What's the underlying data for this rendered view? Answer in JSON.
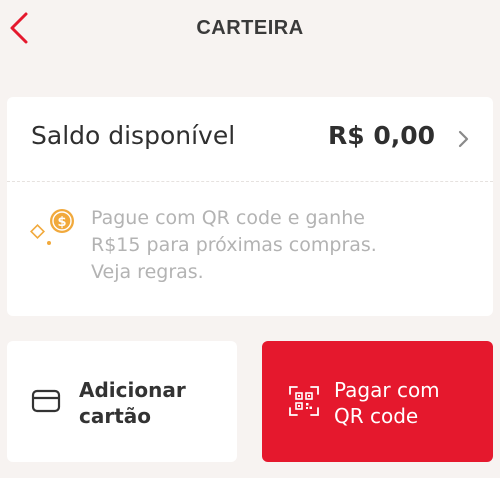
{
  "colors": {
    "background": "#f7f3f1",
    "accent": "#e5182d",
    "coin": "#f1a93c",
    "muted_text": "#b3b3b3"
  },
  "header": {
    "back_icon": "chevron-left-icon",
    "title": "CARTEIRA"
  },
  "balance": {
    "label": "Saldo disponível",
    "value": "R$ 0,00",
    "chevron_icon": "chevron-right-icon"
  },
  "promo": {
    "icon": "coin-icon",
    "lines": [
      "Pague com QR code e ganhe",
      "R$15 para próximas compras.",
      "Veja regras."
    ]
  },
  "actions": {
    "add_card": {
      "icon": "credit-card-icon",
      "line1": "Adicionar",
      "line2": "cartão"
    },
    "pay_qr": {
      "icon": "qr-code-icon",
      "line1": "Pagar com",
      "line2": "QR code"
    }
  }
}
